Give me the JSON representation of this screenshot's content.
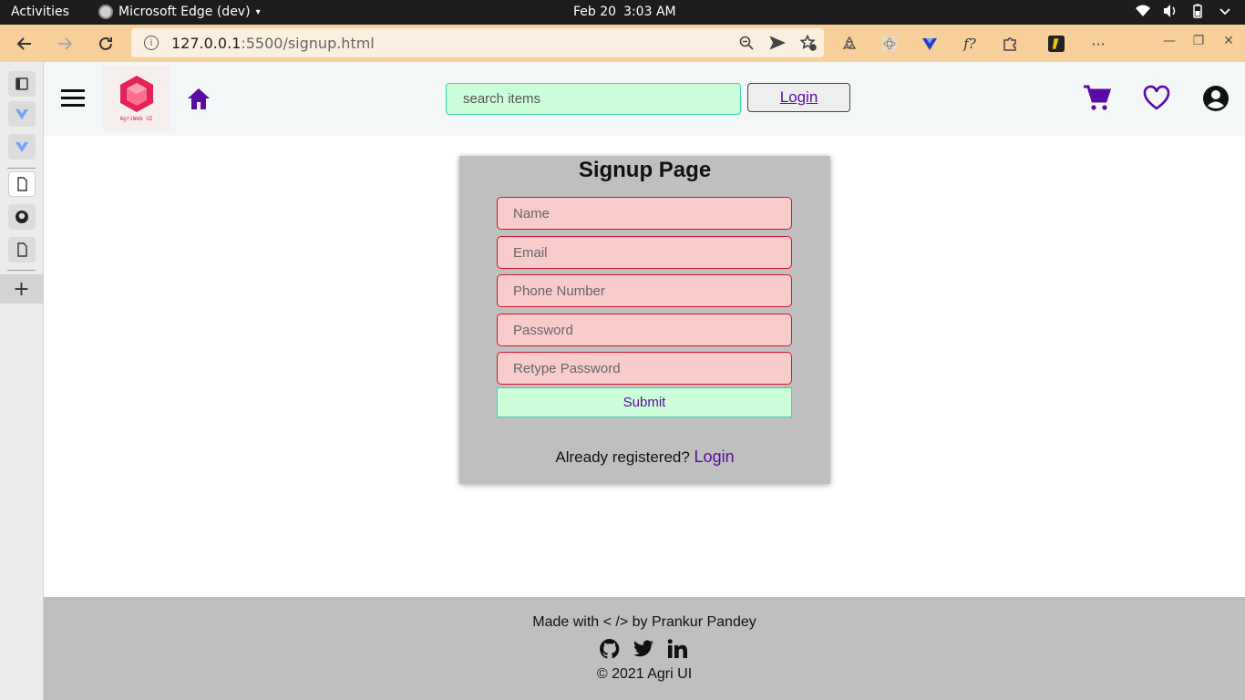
{
  "os_bar": {
    "activities": "Activities",
    "app_name": "Microsoft Edge (dev)",
    "date": "Feb 20",
    "time": "3:03 AM"
  },
  "browser": {
    "url_host": "127.0.0.1",
    "url_path": ":5500/signup.html",
    "accent_color": "#f6cf9a"
  },
  "header": {
    "logo_text": "AgriWeb UI",
    "search_placeholder": "search items",
    "login_label": "Login",
    "icon_color": "#5b0aa3"
  },
  "signup": {
    "title": "Signup Page",
    "fields": [
      {
        "placeholder": "Name"
      },
      {
        "placeholder": "Email"
      },
      {
        "placeholder": "Phone Number"
      },
      {
        "placeholder": "Password"
      },
      {
        "placeholder": "Retype Password"
      }
    ],
    "submit_label": "Submit",
    "already_text": "Already registered?",
    "login_link": "Login"
  },
  "footer": {
    "made_with": "Made with < /> by Prankur Pandey",
    "copyright": "© 2021 Agri UI",
    "social": [
      "github-icon",
      "twitter-icon",
      "linkedin-icon"
    ]
  }
}
